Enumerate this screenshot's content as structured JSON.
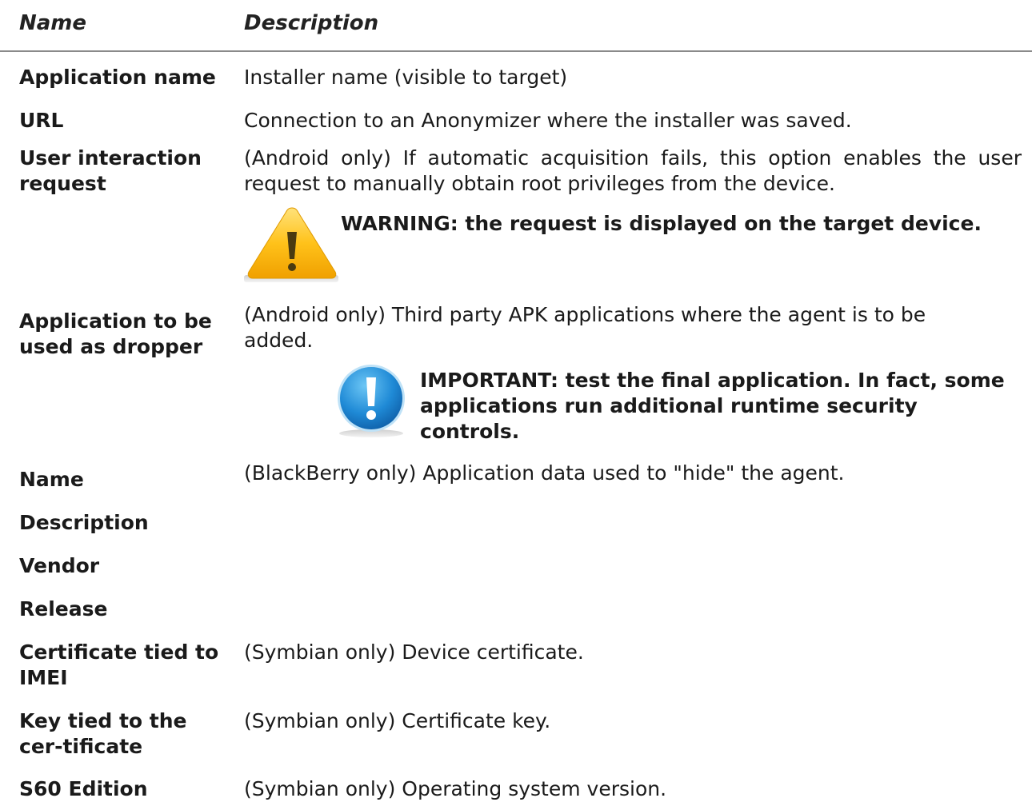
{
  "header": {
    "name": "Name",
    "description": "Description"
  },
  "rows": [
    {
      "name": "Application name",
      "description": "Installer name (visible to target)"
    },
    {
      "name": "URL",
      "description": "Connection to an Anonymizer where the installer was saved."
    },
    {
      "name": "User interaction request",
      "description": "(Android only) If automatic acquisition fails, this option enables the user request to manually obtain root privileges from the device."
    },
    {
      "name": "Application to be used as dropper",
      "description": "(Android only) Third party APK applications where the agent is to be added."
    },
    {
      "name": "Name",
      "description": "(BlackBerry only) Application data used to \"hide\" the agent."
    },
    {
      "name": "Description",
      "description": ""
    },
    {
      "name": "Vendor",
      "description": ""
    },
    {
      "name": "Release",
      "description": ""
    },
    {
      "name": "Certificate tied to IMEI",
      "description": "(Symbian only) Device certificate."
    },
    {
      "name": "Key tied to the cer-tificate",
      "description": "(Symbian only) Certificate key."
    },
    {
      "name": "S60 Edition",
      "description": "(Symbian only) Operating system version."
    }
  ],
  "warning": {
    "icon": "warning-icon",
    "text": "WARNING: the request is displayed on the target device."
  },
  "important": {
    "icon": "important-icon",
    "text": "IMPORTANT:  test the final application. In fact, some applications run additional runtime security controls."
  },
  "colors": {
    "rule": "#8a8a8a",
    "warning": "#f5b800",
    "important": "#1a86d0"
  }
}
